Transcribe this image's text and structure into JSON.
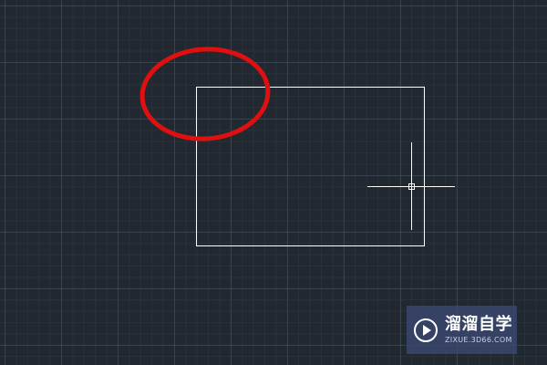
{
  "canvas": {
    "background_color": "#212830",
    "grid_major_color": "#465260",
    "grid_minor_color": "#303842"
  },
  "drawing": {
    "rectangle": {
      "stroke_color": "#ffffff"
    },
    "highlight": {
      "stroke_color": "#e01010",
      "shape": "ellipse",
      "purpose": "highlighted corner of rectangle"
    },
    "cursor": {
      "type": "crosshair",
      "color": "#ffffff"
    }
  },
  "watermark": {
    "logo_icon": "play-circle-icon",
    "title": "溜溜自学",
    "url": "ZIXUE.3D66.COM",
    "background_color": "#3a4870"
  }
}
